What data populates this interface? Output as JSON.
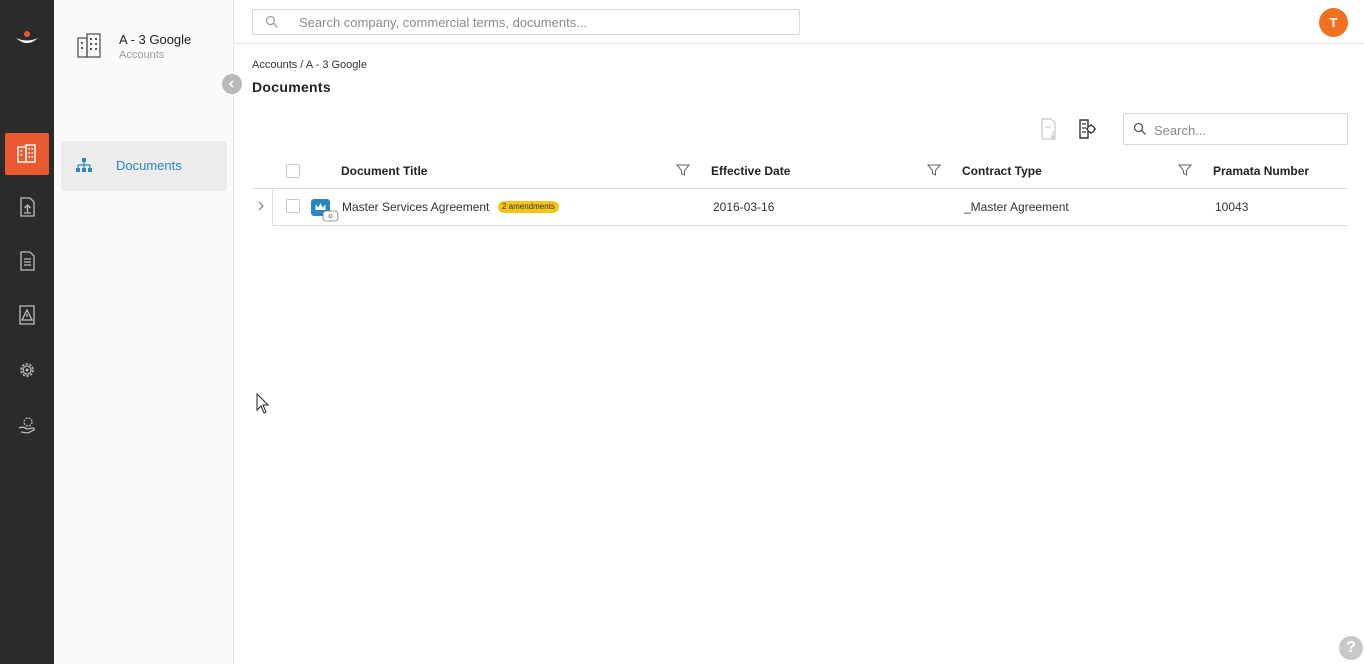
{
  "rail": {
    "items": [
      {
        "icon": "building-icon",
        "active": true
      },
      {
        "icon": "upload-document-icon",
        "active": false
      },
      {
        "icon": "document-icon",
        "active": false
      },
      {
        "icon": "alert-document-icon",
        "active": false
      },
      {
        "icon": "gear-icon",
        "active": false
      },
      {
        "icon": "hand-gear-icon",
        "active": false
      }
    ],
    "active_color": "#ea5a31"
  },
  "account": {
    "name": "A - 3 Google",
    "subtitle": "Accounts"
  },
  "nav": {
    "items": [
      {
        "label": "Documents",
        "icon": "hierarchy-icon"
      }
    ]
  },
  "topbar": {
    "search_placeholder": "Search company, commercial terms, documents...",
    "avatar_initial": "T",
    "avatar_color": "#f0711f"
  },
  "breadcrumb": "Accounts / A - 3 Google",
  "page_title": "Documents",
  "grid": {
    "search_placeholder": "Search...",
    "columns": [
      "Document Title",
      "Effective Date",
      "Contract Type",
      "Pramata Number"
    ],
    "rows": [
      {
        "title": "Master Services Agreement",
        "badge": "2 amendments",
        "effective_date": "2016-03-16",
        "contract_type": "_Master Agreement",
        "pramata_number": "10043"
      }
    ]
  },
  "help_label": "?"
}
